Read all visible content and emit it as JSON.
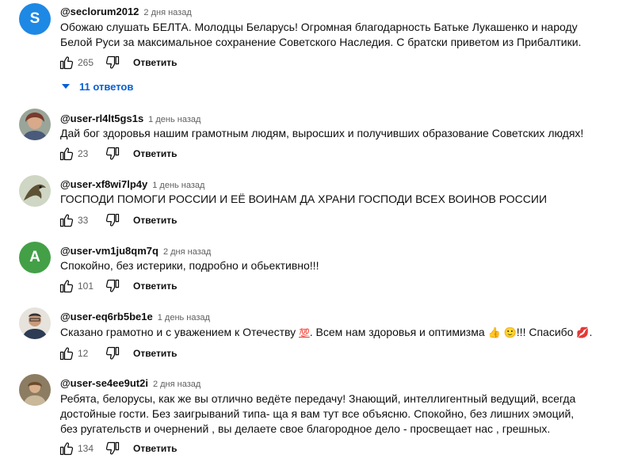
{
  "comments": [
    {
      "author": "@seclorum2012",
      "time": "2 дня назад",
      "avatar_letter": "S",
      "avatar_color": "#1e88e5",
      "text": "Обожаю слушать БЕЛТА. Молодцы Беларусь! Огромная благодарность Батьке Лукашенко и народу Белой Руси за максимальное сохранение Советского Наследия. С братски приветом из Прибалтики.",
      "likes": "265",
      "reply": "Ответить",
      "replies_label": "11 ответов"
    },
    {
      "author": "@user-rl4lt5gs1s",
      "time": "1 день назад",
      "text": "Дай бог здоровья нашим грамотным людям, выросших и получивших образование Советских людях!",
      "likes": "23",
      "reply": "Ответить"
    },
    {
      "author": "@user-xf8wi7lp4y",
      "time": "1 день назад",
      "text": "ГОСПОДИ ПОМОГИ РОССИИ И ЕЁ ВОИНАМ ДА ХРАНИ ГОСПОДИ ВСЕХ ВОИНОВ РОССИИ",
      "likes": "33",
      "reply": "Ответить"
    },
    {
      "author": "@user-vm1ju8qm7q",
      "time": "2 дня назад",
      "avatar_letter": "A",
      "avatar_color": "#43a047",
      "text": "Спокойно, без истерики, подробно и обьективно!!!",
      "likes": "101",
      "reply": "Ответить"
    },
    {
      "author": "@user-eq6rb5be1e",
      "time": "1 день назад",
      "text_parts": {
        "part1": "Сказано грамотно и с уважением к Отечеству ",
        "emoji1": "💯",
        "part2": ". Всем нам здоровья и оптимизма ",
        "emoji2": "👍",
        "emoji3": "🙂",
        "part3": "!!! Спасибо ",
        "emoji4": "💋",
        "part4": "."
      },
      "likes": "12",
      "reply": "Ответить"
    },
    {
      "author": "@user-se4ee9ut2i",
      "time": "2 дня назад",
      "text": "Ребята, белорусы, как же вы отлично ведёте передачу! Знающий, интеллигентный ведущий, всегда достойные гости. Без заигрываний типа- ща я вам тут все объясню. Спокойно, без лишних эмоций, без ругательств и очернений , вы делаете свое благородное дело - просвещает нас , грешных.",
      "likes": "134",
      "reply": "Ответить"
    }
  ],
  "icons": {
    "like": "thumb-up-icon",
    "dislike": "thumb-down-icon",
    "expand": "caret-down-icon"
  }
}
